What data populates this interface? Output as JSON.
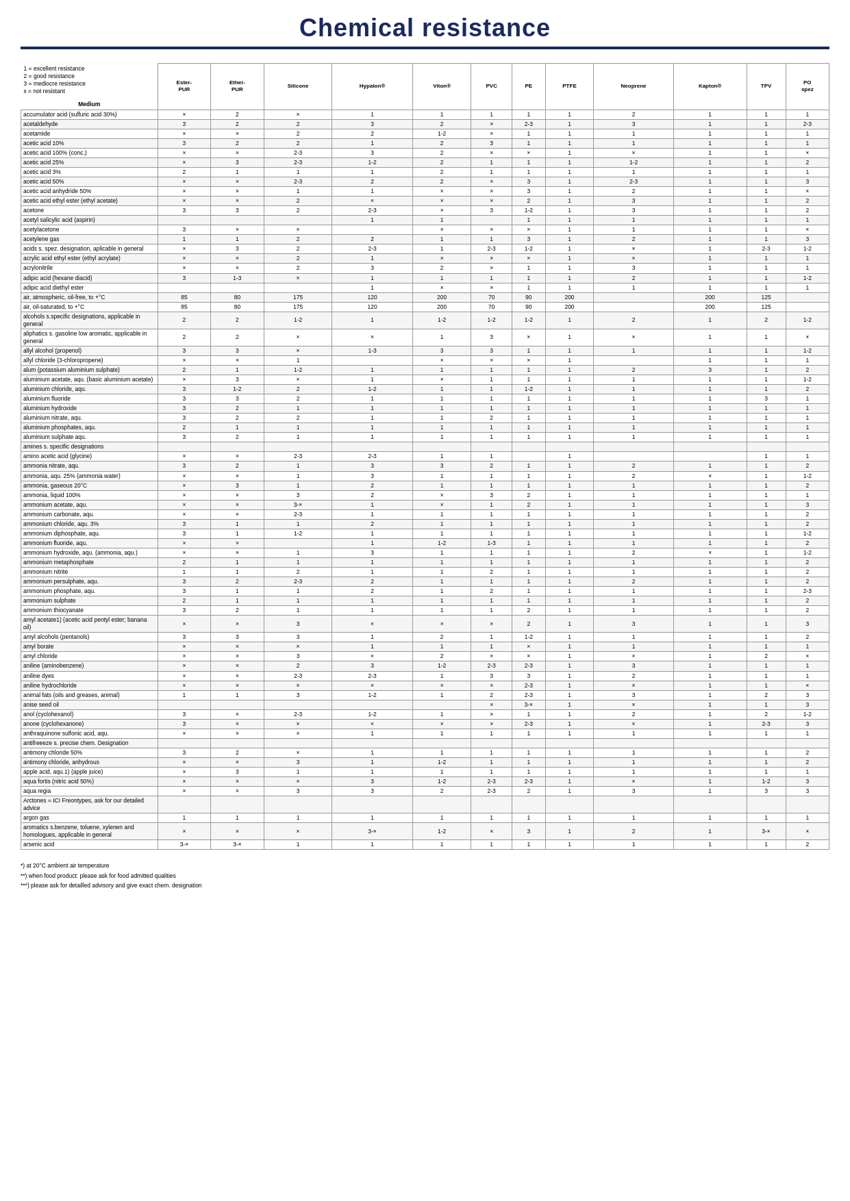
{
  "title": "Chemical resistance",
  "legend": {
    "lines": [
      "1 = excellent resistance",
      "2 = good resistance",
      "3 = mediocre resistance",
      "x = not resistant"
    ]
  },
  "medium_label": "Medium",
  "columns": [
    "Ester-PUR",
    "Ether-PUR",
    "Silicone",
    "Hypalon®",
    "Viton®",
    "PVC",
    "PE",
    "PTFE",
    "Neoprene",
    "Kapton®",
    "TPV",
    "PO spez"
  ],
  "rows": [
    [
      "accumulator acid (sulfuric acid 30%)",
      "×",
      "2",
      "×",
      "1",
      "1",
      "1",
      "1",
      "1",
      "2",
      "1",
      "1",
      "1"
    ],
    [
      "acetaldehyde",
      "3",
      "2",
      "2",
      "3",
      "2",
      "×",
      "2-3",
      "1",
      "3",
      "1",
      "1",
      "2-3"
    ],
    [
      "acetamide",
      "×",
      "×",
      "2",
      "2",
      "1-2",
      "×",
      "1",
      "1",
      "1",
      "1",
      "1",
      "1"
    ],
    [
      "acetic acid 10%",
      "3",
      "2",
      "2",
      "1",
      "2",
      "3",
      "1",
      "1",
      "1",
      "1",
      "1",
      "1"
    ],
    [
      "acetic acid 100% (conc.)",
      "×",
      "×",
      "2-3",
      "3",
      "2",
      "×",
      "×",
      "1",
      "×",
      "1",
      "1",
      "×"
    ],
    [
      "acetic acid 25%",
      "×",
      "3",
      "2-3",
      "1-2",
      "2",
      "1",
      "1",
      "1",
      "1-2",
      "1",
      "1",
      "2"
    ],
    [
      "acetic acid 3%",
      "2",
      "1",
      "1",
      "1",
      "2",
      "1",
      "1",
      "1",
      "1",
      "1",
      "1",
      "1"
    ],
    [
      "acetic acid 50%",
      "×",
      "×",
      "2-3",
      "2",
      "2",
      "×",
      "3",
      "1",
      "2-3",
      "1",
      "1",
      "3"
    ],
    [
      "acetic acid anhydride 50%",
      "×",
      "×",
      "1",
      "1",
      "×",
      "×",
      "3",
      "1",
      "2",
      "1",
      "1",
      "×"
    ],
    [
      "acetic acid ethyl ester (ethyl acetate)",
      "×",
      "×",
      "2",
      "×",
      "×",
      "×",
      "2",
      "1",
      "3",
      "1",
      "1",
      "2"
    ],
    [
      "acetone",
      "3",
      "3",
      "2",
      "2-3",
      "×",
      "3",
      "1-2",
      "1",
      "3",
      "1",
      "1",
      "2"
    ],
    [
      "acetyl salicylic acid (aspirin)",
      "",
      "",
      "",
      "1",
      "1",
      "",
      "1",
      "1",
      "1",
      "1",
      "1",
      "1"
    ],
    [
      "acetylacetone",
      "3",
      "×",
      "×",
      "",
      "×",
      "×",
      "×",
      "1",
      "1",
      "1",
      "1",
      "×"
    ],
    [
      "acetylene gas",
      "1",
      "1",
      "2",
      "2",
      "1",
      "1",
      "3",
      "1",
      "2",
      "1",
      "1",
      "3"
    ],
    [
      "acids s. spez. designation, aplicable in general",
      "×",
      "3",
      "2",
      "2-3",
      "1",
      "2-3",
      "1-2",
      "1",
      "×",
      "1",
      "2-3",
      "1-2"
    ],
    [
      "acrylic acid ethyl ester (ethyl acrylate)",
      "×",
      "×",
      "2",
      "1",
      "×",
      "×",
      "×",
      "1",
      "×",
      "1",
      "1",
      "1"
    ],
    [
      "acrylonitrile",
      "×",
      "×",
      "2",
      "3",
      "2",
      "×",
      "1",
      "1",
      "3",
      "1",
      "1",
      "1"
    ],
    [
      "adipic acid (hexane diacid)",
      "3",
      "1-3",
      "×",
      "1",
      "1",
      "1",
      "1",
      "1",
      "2",
      "1",
      "1",
      "1-2"
    ],
    [
      "adipic acid diethyl ester",
      "",
      "",
      "",
      "1",
      "×",
      "×",
      "1",
      "1",
      "1",
      "1",
      "1",
      "1"
    ],
    [
      "air, atmospheric, oil-free, to +°C",
      "85",
      "80",
      "175",
      "120",
      "200",
      "70",
      "90",
      "200",
      "",
      "200",
      "125",
      ""
    ],
    [
      "air, oil-saturated, to  +°C",
      "85",
      "80",
      "175",
      "120",
      "200",
      "70",
      "90",
      "200",
      "",
      "200",
      "125",
      ""
    ],
    [
      "alcohols s.specific designations, applicable in general",
      "2",
      "2",
      "1-2",
      "1",
      "1-2",
      "1-2",
      "1-2",
      "1",
      "2",
      "1",
      "2",
      "1-2"
    ],
    [
      "aliphatics s. gasoline low aromatic, applicable in general",
      "2",
      "2",
      "×",
      "×",
      "1",
      "3",
      "×",
      "1",
      "×",
      "1",
      "1",
      "×"
    ],
    [
      "allyl alcohol (propenol)",
      "3",
      "3",
      "×",
      "1-3",
      "3",
      "3",
      "1",
      "1",
      "1",
      "1",
      "1",
      "1-2"
    ],
    [
      "allyl chloride (3-chloropropene)",
      "×",
      "×",
      "1",
      "",
      "×",
      "×",
      "×",
      "1",
      "",
      "1",
      "1",
      "1"
    ],
    [
      "alum (potassium aluminium sulphate)",
      "2",
      "1",
      "1-2",
      "1",
      "1",
      "1",
      "1",
      "1",
      "2",
      "3",
      "1",
      "2"
    ],
    [
      "aluminium acetate, aqu. (basic aluminium acetate)",
      "×",
      "3",
      "×",
      "1",
      "×",
      "1",
      "1",
      "1",
      "1",
      "1",
      "1",
      "1-2"
    ],
    [
      "aluminium chloride, aqu.",
      "3",
      "1-2",
      "2",
      "1-2",
      "1",
      "1",
      "1-2",
      "1",
      "1",
      "1",
      "1",
      "2"
    ],
    [
      "aluminium fluoride",
      "3",
      "3",
      "2",
      "1",
      "1",
      "1",
      "1",
      "1",
      "1",
      "1",
      "3",
      "1"
    ],
    [
      "aluminium hydroxide",
      "3",
      "2",
      "1",
      "1",
      "1",
      "1",
      "1",
      "1",
      "1",
      "1",
      "1",
      "1"
    ],
    [
      "aluminium nitrate, aqu.",
      "3",
      "2",
      "2",
      "1",
      "1",
      "2",
      "1",
      "1",
      "1",
      "1",
      "1",
      "1"
    ],
    [
      "aluminium phosphates, aqu.",
      "2",
      "1",
      "1",
      "1",
      "1",
      "1",
      "1",
      "1",
      "1",
      "1",
      "1",
      "1"
    ],
    [
      "aluminium sulphate aqu.",
      "3",
      "2",
      "1",
      "1",
      "1",
      "1",
      "1",
      "1",
      "1",
      "1",
      "1",
      "1"
    ],
    [
      "amines s. specific designations",
      "",
      "",
      "",
      "",
      "",
      "",
      "",
      "",
      "",
      "",
      "",
      ""
    ],
    [
      "amino acetic acid (glycine)",
      "×",
      "×",
      "2-3",
      "2-3",
      "1",
      "1",
      "",
      "1",
      "",
      "",
      "1",
      "1"
    ],
    [
      "ammonia nitrate, aqu.",
      "3",
      "2",
      "1",
      "3",
      "3",
      "2",
      "1",
      "1",
      "2",
      "1",
      "1",
      "2"
    ],
    [
      "ammonia, aqu. 25% (ammonia water)",
      "×",
      "×",
      "1",
      "3",
      "1",
      "1",
      "1",
      "1",
      "2",
      "×",
      "1",
      "1-2"
    ],
    [
      "ammonia, gaseous 20°C",
      "×",
      "3",
      "1",
      "2",
      "1",
      "1",
      "1",
      "1",
      "1",
      "1",
      "1",
      "2"
    ],
    [
      "ammonia, liquid 100%",
      "×",
      "×",
      "3",
      "2",
      "×",
      "3",
      "2",
      "1",
      "1",
      "1",
      "1",
      "1"
    ],
    [
      "ammonium acetate, aqu.",
      "×",
      "×",
      "3-×",
      "1",
      "×",
      "1",
      "2",
      "1",
      "1",
      "1",
      "1",
      "3"
    ],
    [
      "ammonium carbonate, aqu.",
      "×",
      "×",
      "2-3",
      "1",
      "1",
      "1",
      "1",
      "1",
      "1",
      "1",
      "1",
      "2"
    ],
    [
      "ammonium chloride, aqu.  3%",
      "3",
      "1",
      "1",
      "2",
      "1",
      "1",
      "1",
      "1",
      "1",
      "1",
      "1",
      "2"
    ],
    [
      "ammonium diphosphate, aqu.",
      "3",
      "1",
      "1-2",
      "1",
      "1",
      "1",
      "1",
      "1",
      "1",
      "1",
      "1",
      "1-2"
    ],
    [
      "ammonium fluoride, aqu.",
      "×",
      "×",
      "",
      "1",
      "1-2",
      "1-3",
      "1",
      "1",
      "1",
      "1",
      "1",
      "2"
    ],
    [
      "ammonium hydroxide, aqu. (ammonia, aqu.)",
      "×",
      "×",
      "1",
      "3",
      "1",
      "1",
      "1",
      "1",
      "2",
      "×",
      "1",
      "1-2"
    ],
    [
      "ammonium metaphosphate",
      "2",
      "1",
      "1",
      "1",
      "1",
      "1",
      "1",
      "1",
      "1",
      "1",
      "1",
      "2"
    ],
    [
      "ammonium nitrite",
      "1",
      "1",
      "2",
      "1",
      "1",
      "2",
      "1",
      "1",
      "1",
      "1",
      "1",
      "2"
    ],
    [
      "ammonium persulphate, aqu.",
      "3",
      "2",
      "2-3",
      "2",
      "1",
      "1",
      "1",
      "1",
      "2",
      "1",
      "1",
      "2"
    ],
    [
      "ammonium phosphate, aqu.",
      "3",
      "1",
      "1",
      "2",
      "1",
      "2",
      "1",
      "1",
      "1",
      "1",
      "1",
      "2-3"
    ],
    [
      "ammonium sulphate",
      "2",
      "1",
      "1",
      "1",
      "1",
      "1",
      "1",
      "1",
      "1",
      "1",
      "1",
      "2"
    ],
    [
      "ammonium thiocyanate",
      "3",
      "2",
      "1",
      "1",
      "1",
      "1",
      "2",
      "1",
      "1",
      "1",
      "1",
      "2"
    ],
    [
      "amyl acetate1) (acetic acid pentyl ester; banana oil)",
      "×",
      "×",
      "3",
      "×",
      "×",
      "×",
      "2",
      "1",
      "3",
      "1",
      "1",
      "3"
    ],
    [
      "amyl alcohols (pentanols)",
      "3",
      "3",
      "3",
      "1",
      "2",
      "1",
      "1-2",
      "1",
      "1",
      "1",
      "1",
      "2"
    ],
    [
      "amyl borate",
      "×",
      "×",
      "×",
      "1",
      "1",
      "1",
      "×",
      "1",
      "1",
      "1",
      "1",
      "1"
    ],
    [
      "amyl chloride",
      "×",
      "×",
      "3",
      "×",
      "2",
      "×",
      "×",
      "1",
      "×",
      "1",
      "2",
      "×"
    ],
    [
      "aniline (aminobenzene)",
      "×",
      "×",
      "2",
      "3",
      "1-2",
      "2-3",
      "2-3",
      "1",
      "3",
      "1",
      "1",
      "1"
    ],
    [
      "aniline dyes",
      "×",
      "×",
      "2-3",
      "2-3",
      "1",
      "3",
      "3",
      "1",
      "2",
      "1",
      "1",
      "1"
    ],
    [
      "aniline hydrochloride",
      "×",
      "×",
      "×",
      "×",
      "×",
      "×",
      "2-3",
      "1",
      "×",
      "1",
      "1",
      "×"
    ],
    [
      "animal fats (oils and greases, animal)",
      "1",
      "1",
      "3",
      "1-2",
      "1",
      "2",
      "2-3",
      "1",
      "3",
      "1",
      "2",
      "3"
    ],
    [
      "anise seed oil",
      "",
      "",
      "",
      "",
      "",
      "×",
      "3-×",
      "1",
      "×",
      "1",
      "1",
      "3"
    ],
    [
      "anol (cyclohexanol)",
      "3",
      "×",
      "2-3",
      "1-2",
      "1",
      "×",
      "1",
      "1",
      "2",
      "1",
      "2",
      "1-2"
    ],
    [
      "anone (cyclohexanone)",
      "3",
      "×",
      "×",
      "×",
      "×",
      "×",
      "2-3",
      "1",
      "×",
      "1",
      "2-3",
      "3"
    ],
    [
      "anthraquinone sulfonic acid, aqu.",
      "×",
      "×",
      "×",
      "1",
      "1",
      "1",
      "1",
      "1",
      "1",
      "1",
      "1",
      "1"
    ],
    [
      "antifreeeze s. precise chem. Designation",
      "",
      "",
      "",
      "",
      "",
      "",
      "",
      "",
      "",
      "",
      "",
      ""
    ],
    [
      "antimony chloride 50%",
      "3",
      "2",
      "×",
      "1",
      "1",
      "1",
      "1",
      "1",
      "1",
      "1",
      "1",
      "2"
    ],
    [
      "antimony chloride, anhydrous",
      "×",
      "×",
      "3",
      "1",
      "1-2",
      "1",
      "1",
      "1",
      "1",
      "1",
      "1",
      "2"
    ],
    [
      "apple acid, aqu.1) (apple juice)",
      "×",
      "3",
      "1",
      "1",
      "1",
      "1",
      "1",
      "1",
      "1",
      "1",
      "1",
      "1"
    ],
    [
      "aqua fortis (nitric acid 50%)",
      "×",
      "×",
      "×",
      "3",
      "1-2",
      "2-3",
      "2-3",
      "1",
      "×",
      "1",
      "1-2",
      "3"
    ],
    [
      "aqua regia",
      "×",
      "×",
      "3",
      "3",
      "2",
      "2-3",
      "2",
      "1",
      "3",
      "1",
      "3",
      "3"
    ],
    [
      "Arctones = ICI Freontypes, ask for our detailed advice",
      "",
      "",
      "",
      "",
      "",
      "",
      "",
      "",
      "",
      "",
      "",
      ""
    ],
    [
      "argon gas",
      "1",
      "1",
      "1",
      "1",
      "1",
      "1",
      "1",
      "1",
      "1",
      "1",
      "1",
      "1"
    ],
    [
      "aromatics s.benzene, toluene, xylenen and homologues, applicable in general",
      "×",
      "×",
      "×",
      "3-×",
      "1-2",
      "×",
      "3",
      "1",
      "2",
      "1",
      "3-×",
      "×"
    ],
    [
      "arsenic  acid",
      "3-×",
      "3-×",
      "1",
      "1",
      "1",
      "1",
      "1",
      "1",
      "1",
      "1",
      "1",
      "2"
    ]
  ],
  "footer_notes": [
    "*) at 20°C ambient air temperature",
    "**) when food product: please ask for food admitted qualities",
    "***) please ask for detailled advisory and give exact chem. designation"
  ]
}
